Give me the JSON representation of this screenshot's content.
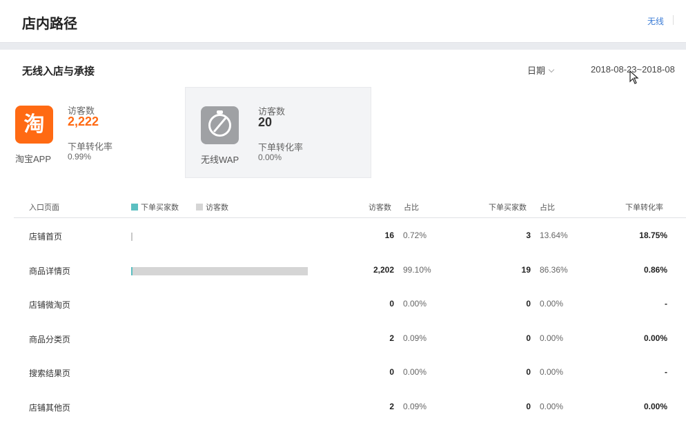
{
  "header": {
    "title": "店内路径",
    "link": "无线"
  },
  "section": {
    "title": "无线入店与承接",
    "date_label": "日期",
    "date_range": "2018-08-23~2018-08"
  },
  "channels": [
    {
      "name": "淘宝APP",
      "icon_glyph": "淘",
      "icon_color": "#ff6a13",
      "visitors_label": "访客数",
      "visitors": "2,222",
      "conv_label": "下单转化率",
      "conv": "0.99%"
    },
    {
      "name": "无线WAP",
      "icon": "compass-icon",
      "visitors_label": "访客数",
      "visitors": "20",
      "conv_label": "下单转化率",
      "conv": "0.00%"
    }
  ],
  "table": {
    "headers": {
      "entry": "入口页面",
      "legend_buyers": "下单买家数",
      "legend_visitors": "访客数",
      "visitors": "访客数",
      "share": "占比",
      "buyers": "下单买家数",
      "buyers_share": "占比",
      "conv": "下单转化率"
    },
    "legend_colors": {
      "buyers": "#5bbfc1",
      "visitors": "#d5d5d5"
    },
    "rows": [
      {
        "name": "店铺首页",
        "visitors": "16",
        "visitors_pct": "0.72%",
        "buyers": "3",
        "buyers_pct": "13.64%",
        "conv": "18.75%",
        "bar": 0.0072
      },
      {
        "name": "商品详情页",
        "visitors": "2,202",
        "visitors_pct": "99.10%",
        "buyers": "19",
        "buyers_pct": "86.36%",
        "conv": "0.86%",
        "bar": 0.991
      },
      {
        "name": "店铺微淘页",
        "visitors": "0",
        "visitors_pct": "0.00%",
        "buyers": "0",
        "buyers_pct": "0.00%",
        "conv": "-",
        "bar": 0
      },
      {
        "name": "商品分类页",
        "visitors": "2",
        "visitors_pct": "0.09%",
        "buyers": "0",
        "buyers_pct": "0.00%",
        "conv": "0.00%",
        "bar": 0.0009
      },
      {
        "name": "搜索结果页",
        "visitors": "0",
        "visitors_pct": "0.00%",
        "buyers": "0",
        "buyers_pct": "0.00%",
        "conv": "-",
        "bar": 0
      },
      {
        "name": "店铺其他页",
        "visitors": "2",
        "visitors_pct": "0.09%",
        "buyers": "0",
        "buyers_pct": "0.00%",
        "conv": "0.00%",
        "bar": 0.0009
      }
    ]
  }
}
